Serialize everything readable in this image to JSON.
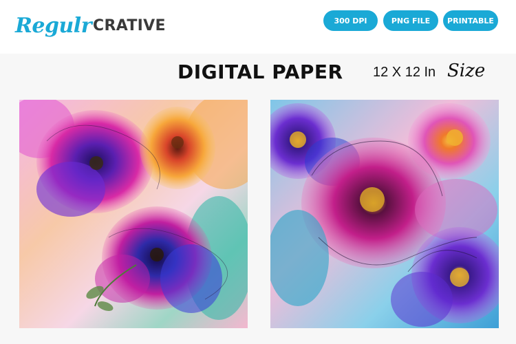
{
  "brand": {
    "script": "Regulr",
    "caps": "CRATIVE",
    "accent_color": "#1aa9d6"
  },
  "badges": [
    "300 DPI",
    "PNG FILE",
    "PRINTABLE"
  ],
  "heading": {
    "title": "DIGITAL PAPER",
    "size_prefix": "12 X 12 In",
    "size_word": "Size"
  },
  "papers": [
    {
      "icon": "floral-alcohol-ink-pattern-icon"
    },
    {
      "icon": "floral-alcohol-ink-pattern-icon"
    }
  ]
}
